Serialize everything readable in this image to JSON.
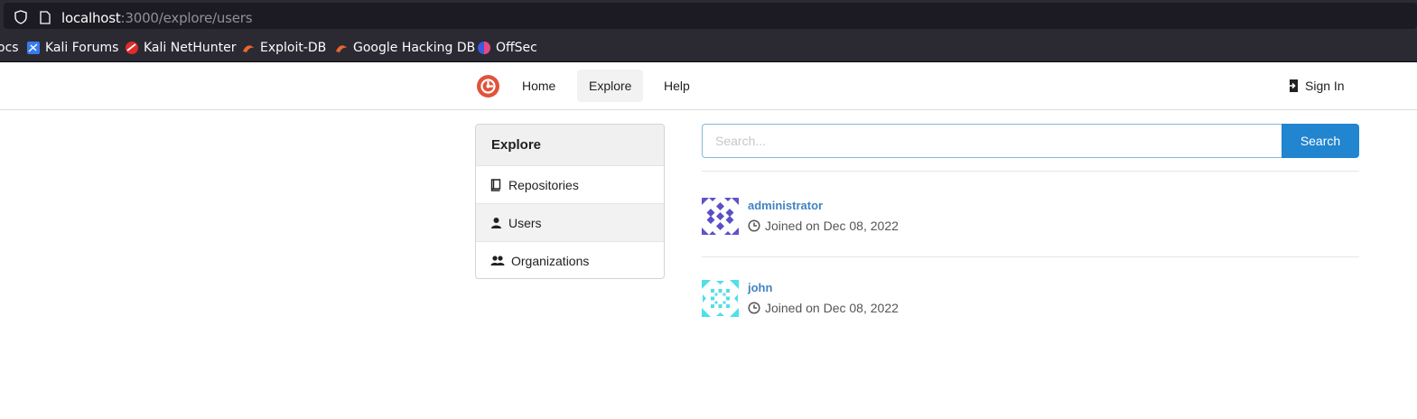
{
  "browser": {
    "url_host": "localhost",
    "url_rest": ":3000/explore/users",
    "bookmarks": [
      {
        "label": "ocs",
        "icon": "none"
      },
      {
        "label": "Kali Forums",
        "icon": "kali-forums-icon"
      },
      {
        "label": "Kali NetHunter",
        "icon": "kali-nethunter-icon"
      },
      {
        "label": "Exploit-DB",
        "icon": "exploit-db-icon"
      },
      {
        "label": "Google Hacking DB",
        "icon": "ghdb-icon"
      },
      {
        "label": "OffSec",
        "icon": "offsec-icon"
      }
    ]
  },
  "nav": {
    "home": "Home",
    "explore": "Explore",
    "help": "Help",
    "sign_in": "Sign In"
  },
  "sidebar": {
    "header": "Explore",
    "items": [
      {
        "label": "Repositories",
        "icon": "book-icon"
      },
      {
        "label": "Users",
        "icon": "person-icon"
      },
      {
        "label": "Organizations",
        "icon": "people-icon"
      }
    ]
  },
  "search": {
    "placeholder": "Search...",
    "value": "",
    "button": "Search"
  },
  "users": [
    {
      "name": "administrator",
      "joined": "Joined on Dec 08, 2022",
      "avatar_color": "#5b4fc8"
    },
    {
      "name": "john",
      "joined": "Joined on Dec 08, 2022",
      "avatar_color": "#4fe0e8"
    }
  ],
  "colors": {
    "accent": "#2185d0",
    "link": "#4183c4",
    "logo": "#e0533b"
  }
}
